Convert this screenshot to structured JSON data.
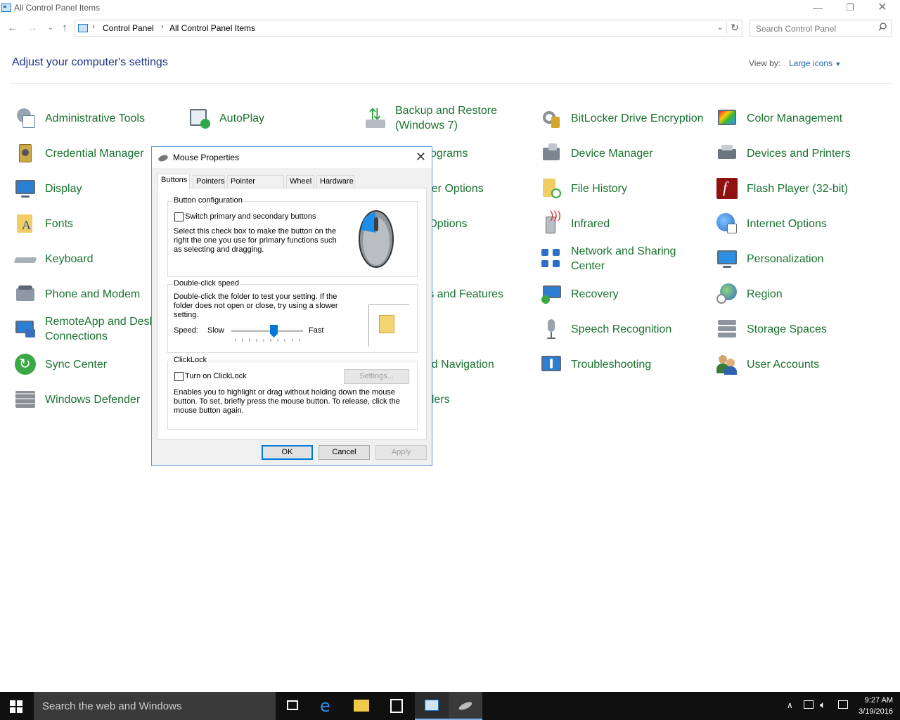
{
  "window": {
    "title": "All Control Panel Items"
  },
  "address": {
    "crumbs": [
      "Control Panel",
      "All Control Panel Items"
    ],
    "search_placeholder": "Search Control Panel"
  },
  "header": {
    "heading": "Adjust your computer's settings",
    "view_by_label": "View by:",
    "view_by_value": "Large icons"
  },
  "items": [
    {
      "label": "Administrative Tools"
    },
    {
      "label": "AutoPlay"
    },
    {
      "label": "Backup and Restore (Windows 7)"
    },
    {
      "label": "BitLocker Drive Encryption"
    },
    {
      "label": "Color Management"
    },
    {
      "label": "Credential Manager"
    },
    {
      "label": "Programs"
    },
    {
      "label": "Device Manager"
    },
    {
      "label": "Devices and Printers"
    },
    {
      "label": "Display"
    },
    {
      "label": "lorer Options"
    },
    {
      "label": "File History"
    },
    {
      "label": "Flash Player (32-bit)"
    },
    {
      "label": "Fonts"
    },
    {
      "label": "g Options"
    },
    {
      "label": "Infrared"
    },
    {
      "label": "Internet Options"
    },
    {
      "label": "Keyboard"
    },
    {
      "label": "Network and Sharing Center"
    },
    {
      "label": "Personalization"
    },
    {
      "label": "Phone and Modem"
    },
    {
      "label": "ms and Features"
    },
    {
      "label": "Recovery"
    },
    {
      "label": "Region"
    },
    {
      "label": "RemoteApp and Desktop Connections"
    },
    {
      "label": "Speech Recognition"
    },
    {
      "label": "Storage Spaces"
    },
    {
      "label": "Sync Center"
    },
    {
      "label": "and Navigation"
    },
    {
      "label": "Troubleshooting"
    },
    {
      "label": "User Accounts"
    },
    {
      "label": "Windows Defender"
    },
    {
      "label": "olders"
    }
  ],
  "dialog": {
    "title": "Mouse Properties",
    "tabs": [
      "Buttons",
      "Pointers",
      "Pointer Options",
      "Wheel",
      "Hardware"
    ],
    "active_tab": "Buttons",
    "button_config": {
      "title": "Button configuration",
      "checkbox_label": "Switch primary and secondary buttons",
      "checked": false,
      "description": "Select this check box to make the button on the right the one you use for primary functions such as selecting and dragging."
    },
    "double_click": {
      "title": "Double-click speed",
      "description": "Double-click the folder to test your setting. If the folder does not open or close, try using a slower setting.",
      "speed_label": "Speed:",
      "slow_label": "Slow",
      "fast_label": "Fast",
      "slider_fraction": 0.6
    },
    "clicklock": {
      "title": "ClickLock",
      "checkbox_label": "Turn on ClickLock",
      "checked": false,
      "settings_label": "Settings...",
      "description": "Enables you to highlight or drag without holding down the mouse button. To set, briefly press the mouse button. To release, click the mouse button again."
    },
    "buttons": {
      "ok": "OK",
      "cancel": "Cancel",
      "apply": "Apply"
    }
  },
  "taskbar": {
    "search_placeholder": "Search the web and Windows",
    "time": "9:27 AM",
    "date": "3/19/2016"
  },
  "colors": {
    "link_green": "#1a7230",
    "heading_blue": "#1e3287",
    "accent": "#0078d7",
    "taskbar": "#101010"
  }
}
